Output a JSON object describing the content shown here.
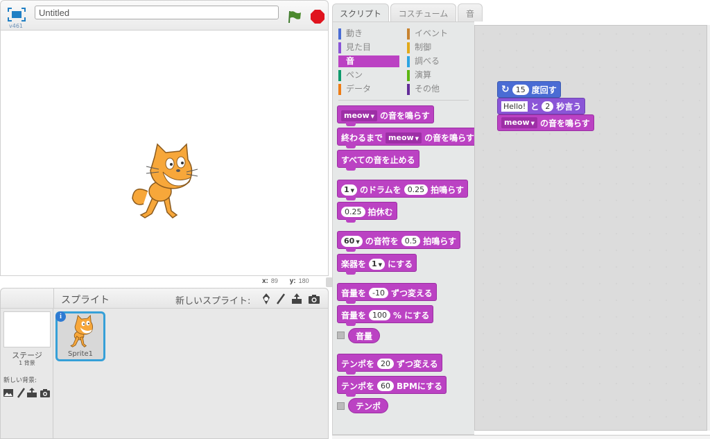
{
  "header": {
    "version": "v461",
    "project_title": "Untitled",
    "project_title_placeholder": "Untitled"
  },
  "stage": {
    "sprite_name": "Sprite1",
    "mouse_x_label": "x:",
    "mouse_x": "89",
    "mouse_y_label": "y:",
    "mouse_y": "180"
  },
  "sprite_pane": {
    "title": "スプライト",
    "new_sprite_label": "新しいスプライト:",
    "new_sprite_icons": [
      "sprite-library-icon",
      "paint-brush-icon",
      "upload-icon",
      "camera-icon"
    ],
    "stage_label": "ステージ",
    "stage_backdrop_count": "1 背景",
    "new_backdrop_label": "新しい背景:",
    "new_backdrop_icons": [
      "backdrop-library-icon",
      "paint-brush-icon",
      "upload-icon",
      "camera-icon"
    ],
    "sprites": [
      {
        "name": "Sprite1",
        "selected": true
      }
    ]
  },
  "tabs": [
    {
      "label": "スクリプト",
      "active": true
    },
    {
      "label": "コスチューム",
      "active": false
    },
    {
      "label": "音",
      "active": false
    }
  ],
  "categories": [
    {
      "label": "動き",
      "color": "#4a6cd4"
    },
    {
      "label": "見た目",
      "color": "#8a55d7"
    },
    {
      "label": "音",
      "color": "#bb42c3",
      "active": true
    },
    {
      "label": "ペン",
      "color": "#0e9a6c"
    },
    {
      "label": "データ",
      "color": "#ee7d16"
    },
    {
      "label": "イベント",
      "color": "#c88330"
    },
    {
      "label": "制御",
      "color": "#e1a91a"
    },
    {
      "label": "調べる",
      "color": "#2ca5e2"
    },
    {
      "label": "演算",
      "color": "#5cb712"
    },
    {
      "label": "その他",
      "color": "#632d99"
    }
  ],
  "palette_blocks": {
    "play_sound": {
      "dropdown": "meow",
      "text": "の音を鳴らす"
    },
    "play_sound_until_done": {
      "prefix": "終わるまで",
      "dropdown": "meow",
      "text": "の音を鳴らす"
    },
    "stop_all_sounds": {
      "text": "すべての音を止める"
    },
    "play_drum": {
      "drum": "1",
      "t1": "のドラムを",
      "beats": "0.25",
      "t2": "拍鳴らす"
    },
    "rest": {
      "beats": "0.25",
      "text": "拍休む"
    },
    "play_note": {
      "note": "60",
      "t1": "の音符を",
      "beats": "0.5",
      "t2": "拍鳴らす"
    },
    "set_instrument": {
      "t1": "楽器を",
      "value": "1",
      "t2": "にする"
    },
    "change_volume": {
      "t1": "音量を",
      "value": "-10",
      "t2": "ずつ変える"
    },
    "set_volume": {
      "t1": "音量を",
      "value": "100",
      "t2": "% にする"
    },
    "volume_reporter": {
      "text": "音量"
    },
    "change_tempo": {
      "t1": "テンポを",
      "value": "20",
      "t2": "ずつ変える"
    },
    "set_tempo": {
      "t1": "テンポを",
      "value": "60",
      "t2": "BPMにする"
    },
    "tempo_reporter": {
      "text": "テンポ"
    }
  },
  "script": {
    "turn": {
      "value": "15",
      "text": "度回す"
    },
    "say": {
      "message": "Hello!",
      "t1": "と",
      "secs": "2",
      "t2": "秒言う"
    },
    "play_sound": {
      "dropdown": "meow",
      "text": "の音を鳴らす"
    }
  }
}
